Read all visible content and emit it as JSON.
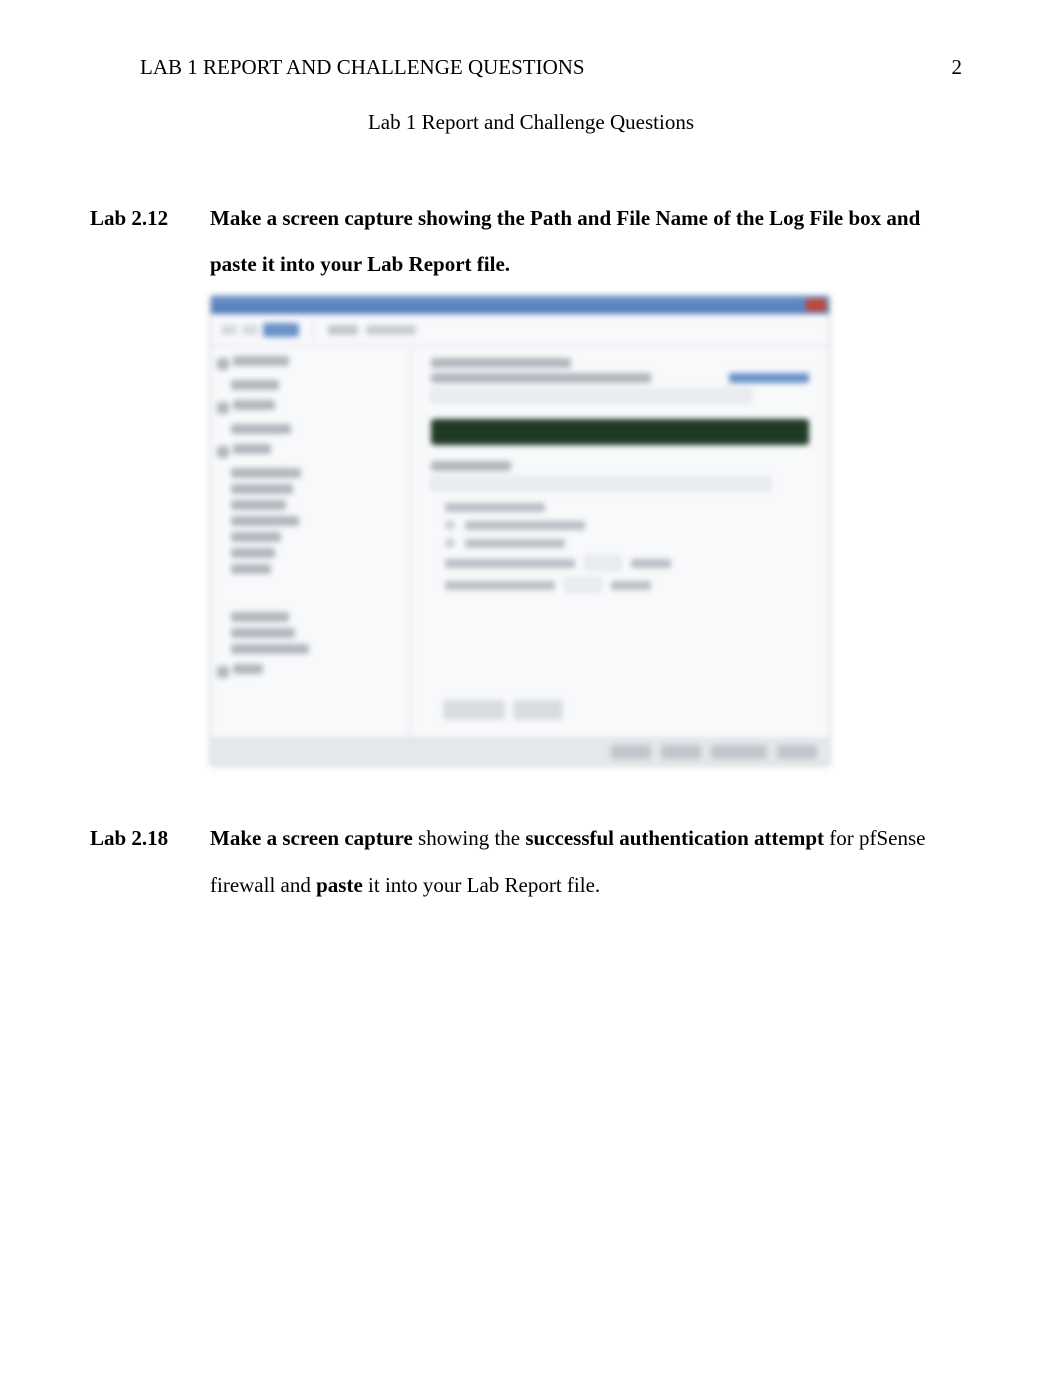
{
  "header": {
    "running": "LAB 1 REPORT AND CHALLENGE QUESTIONS",
    "page_number": "2"
  },
  "title": "Lab 1 Report and Challenge Questions",
  "items": [
    {
      "label": "Lab 2.12",
      "parts": [
        {
          "text": "Make a screen capture showing the Path and File Name of the Log File box and paste it into your Lab Report file.",
          "bold": true
        }
      ]
    },
    {
      "label": "Lab 2.18",
      "parts": [
        {
          "text": "Make a screen capture",
          "bold": true
        },
        {
          "text": " showing the ",
          "bold": false
        },
        {
          "text": "successful authentication attempt",
          "bold": true
        },
        {
          "text": " for pfSense firewall and ",
          "bold": false
        },
        {
          "text": "paste",
          "bold": true
        },
        {
          "text": " it into your Lab Report file.",
          "bold": false
        }
      ]
    }
  ]
}
